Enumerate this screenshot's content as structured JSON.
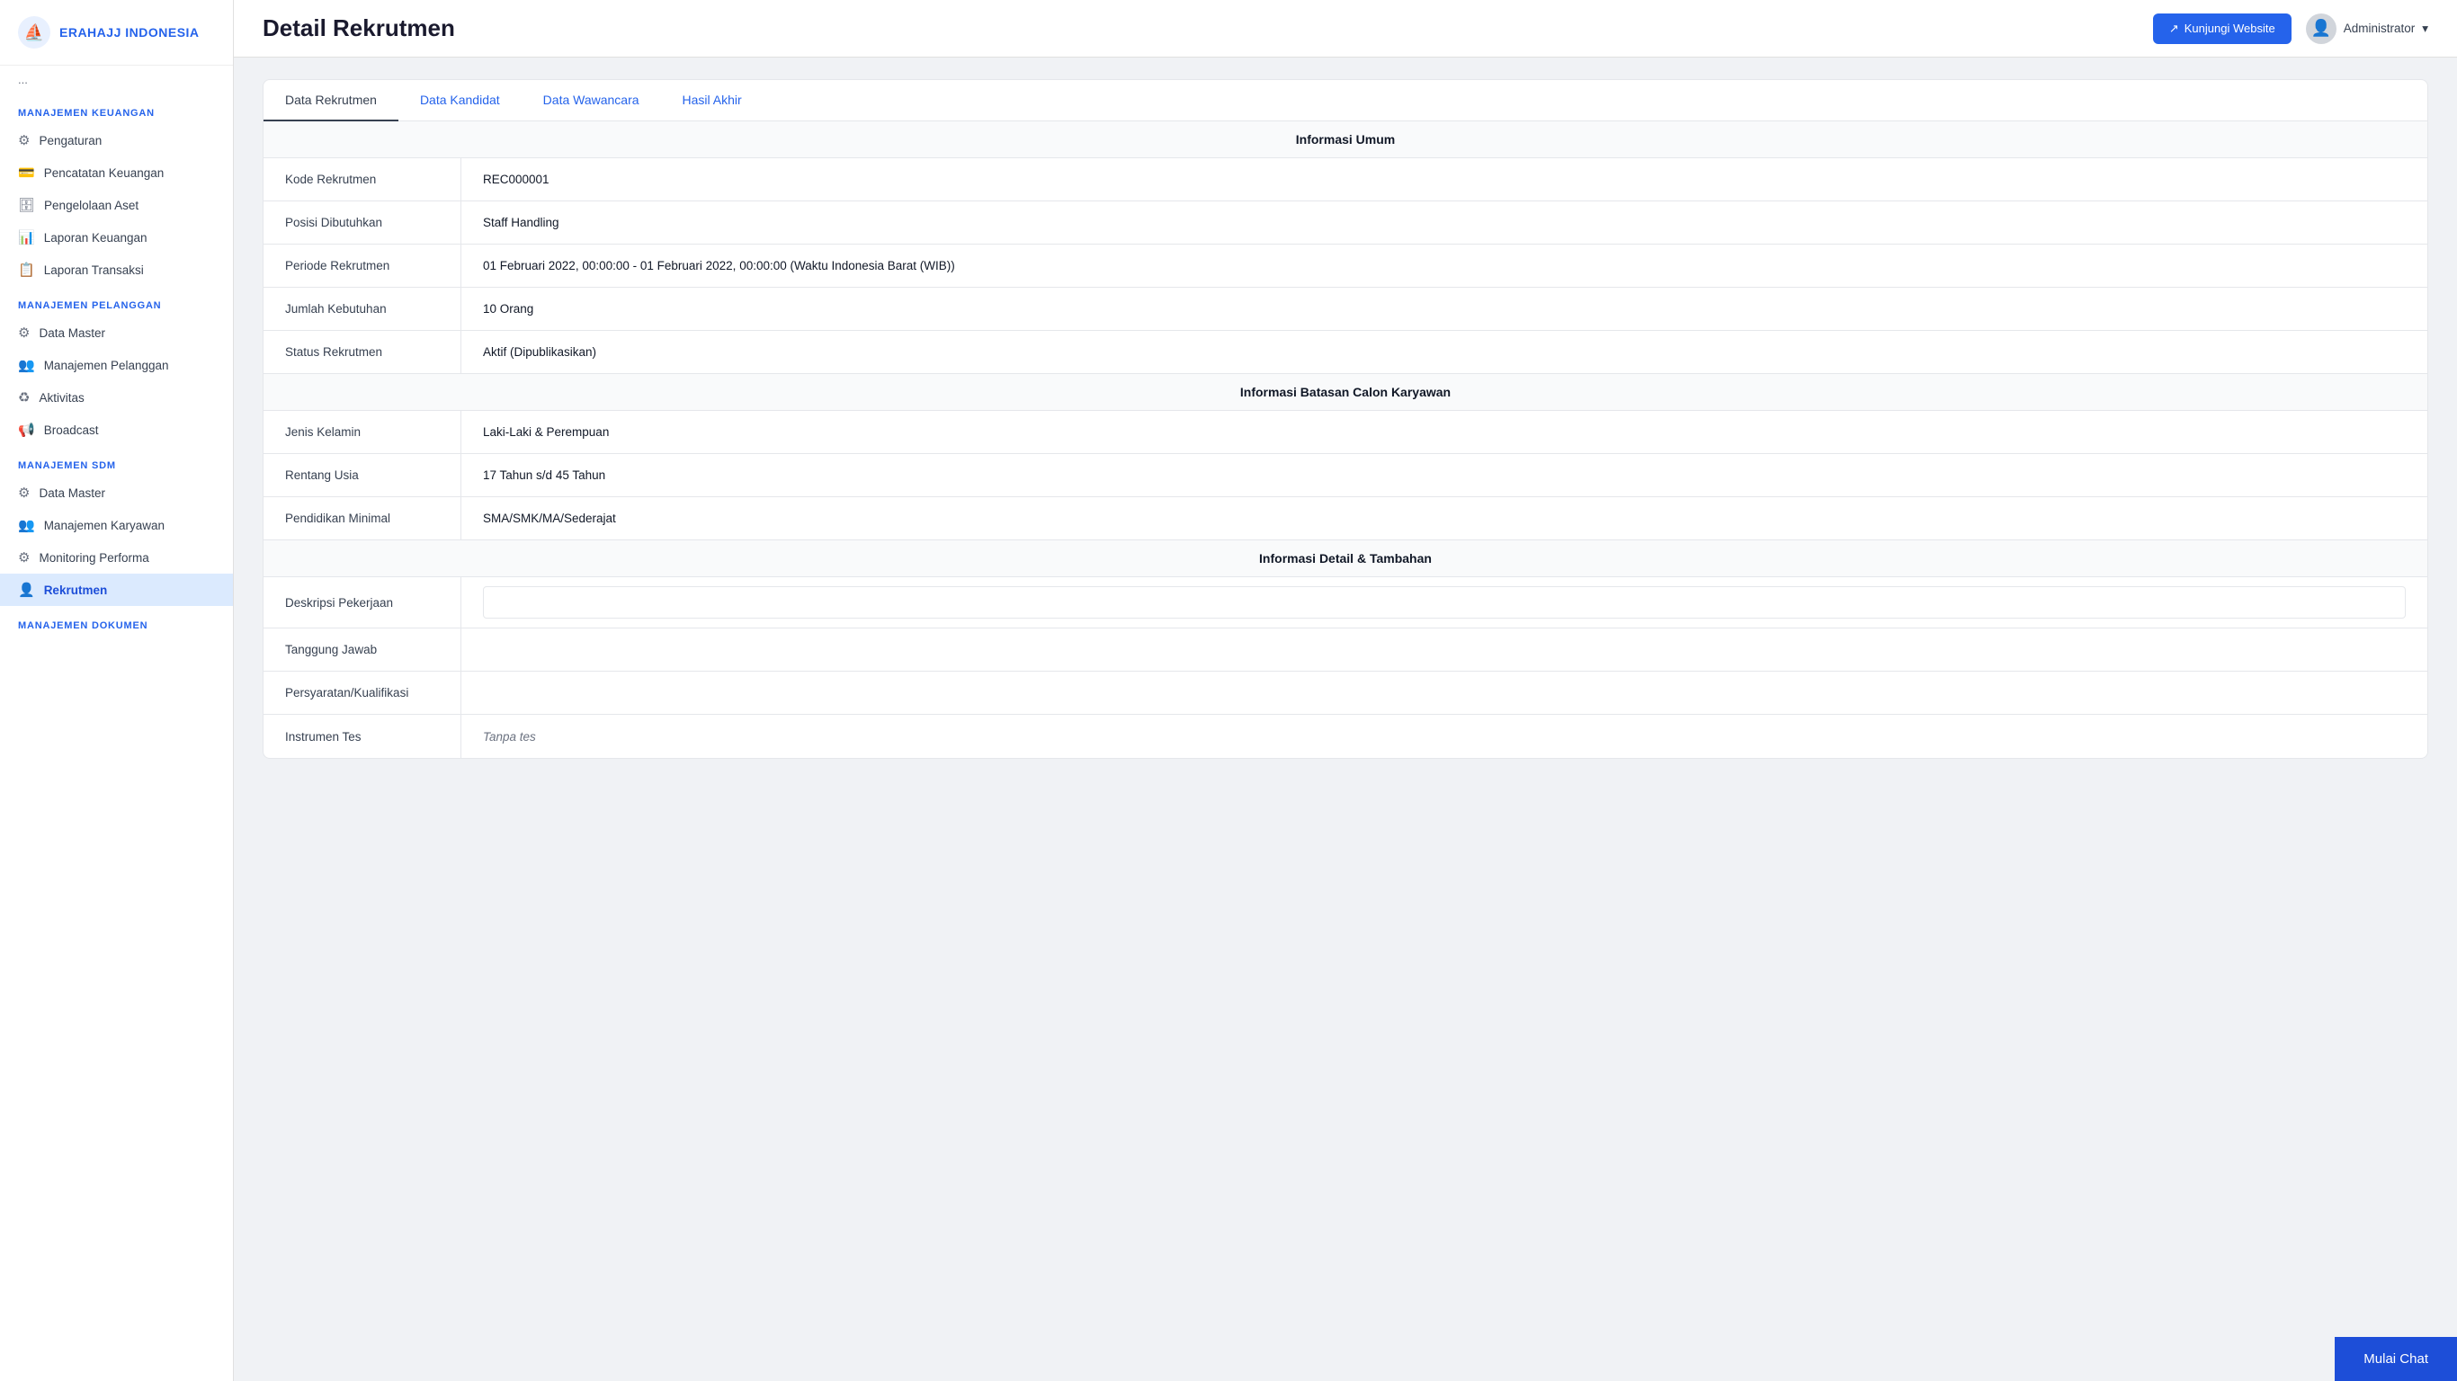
{
  "app": {
    "name": "ERAHAJJ INDONESIA"
  },
  "topbar": {
    "title": "Detail Rekrutmen",
    "visit_button": "Kunjungi Website",
    "admin_label": "Administrator"
  },
  "sidebar": {
    "stub_label": "...",
    "sections": [
      {
        "label": "MANAJEMEN KEUANGAN",
        "items": [
          {
            "id": "pengaturan",
            "label": "Pengaturan",
            "icon": "⚙"
          },
          {
            "id": "pencatatan-keuangan",
            "label": "Pencatatan Keuangan",
            "icon": "💳"
          },
          {
            "id": "pengelolaan-aset",
            "label": "Pengelolaan Aset",
            "icon": "🗄"
          },
          {
            "id": "laporan-keuangan",
            "label": "Laporan Keuangan",
            "icon": "📊"
          },
          {
            "id": "laporan-transaksi",
            "label": "Laporan Transaksi",
            "icon": "📋"
          }
        ]
      },
      {
        "label": "MANAJEMEN PELANGGAN",
        "items": [
          {
            "id": "data-master-pelanggan",
            "label": "Data Master",
            "icon": "⚙"
          },
          {
            "id": "manajemen-pelanggan",
            "label": "Manajemen Pelanggan",
            "icon": "👥"
          },
          {
            "id": "aktivitas",
            "label": "Aktivitas",
            "icon": "♻"
          },
          {
            "id": "broadcast",
            "label": "Broadcast",
            "icon": "📢"
          }
        ]
      },
      {
        "label": "MANAJEMEN SDM",
        "items": [
          {
            "id": "data-master-sdm",
            "label": "Data Master",
            "icon": "⚙"
          },
          {
            "id": "manajemen-karyawan",
            "label": "Manajemen Karyawan",
            "icon": "👥"
          },
          {
            "id": "monitoring-performa",
            "label": "Monitoring Performa",
            "icon": "⚙"
          },
          {
            "id": "rekrutmen",
            "label": "Rekrutmen",
            "icon": "👤",
            "active": true
          }
        ]
      },
      {
        "label": "MANAJEMEN DOKUMEN",
        "items": []
      }
    ]
  },
  "tabs": [
    {
      "id": "data-rekrutmen",
      "label": "Data Rekrutmen",
      "active": true
    },
    {
      "id": "data-kandidat",
      "label": "Data Kandidat",
      "active": false
    },
    {
      "id": "data-wawancara",
      "label": "Data Wawancara",
      "active": false
    },
    {
      "id": "hasil-akhir",
      "label": "Hasil Akhir",
      "active": false
    }
  ],
  "detail": {
    "sections": [
      {
        "header": "Informasi Umum",
        "rows": [
          {
            "label": "Kode Rekrutmen",
            "value": "REC000001",
            "type": "text"
          },
          {
            "label": "Posisi Dibutuhkan",
            "value": "Staff Handling",
            "type": "text"
          },
          {
            "label": "Periode Rekrutmen",
            "value": "01 Februari 2022, 00:00:00 - 01 Februari 2022, 00:00:00 (Waktu Indonesia Barat (WIB))",
            "type": "text"
          },
          {
            "label": "Jumlah Kebutuhan",
            "value": "10 Orang",
            "type": "text"
          },
          {
            "label": "Status Rekrutmen",
            "value": "Aktif (Dipublikasikan)",
            "type": "text"
          }
        ]
      },
      {
        "header": "Informasi Batasan Calon Karyawan",
        "rows": [
          {
            "label": "Jenis Kelamin",
            "value": "Laki-Laki & Perempuan",
            "type": "text"
          },
          {
            "label": "Rentang Usia",
            "value": "17 Tahun s/d 45 Tahun",
            "type": "text"
          },
          {
            "label": "Pendidikan Minimal",
            "value": "SMA/SMK/MA/Sederajat",
            "type": "text"
          }
        ]
      },
      {
        "header": "Informasi Detail & Tambahan",
        "rows": [
          {
            "label": "Deskripsi Pekerjaan",
            "value": "",
            "type": "input-box"
          },
          {
            "label": "Tanggung Jawab",
            "value": "",
            "type": "text"
          },
          {
            "label": "Persyaratan/Kualifikasi",
            "value": "",
            "type": "text"
          },
          {
            "label": "Instrumen Tes",
            "value": "Tanpa tes",
            "type": "italic"
          }
        ]
      }
    ]
  },
  "chat_button": "Mulai Chat"
}
